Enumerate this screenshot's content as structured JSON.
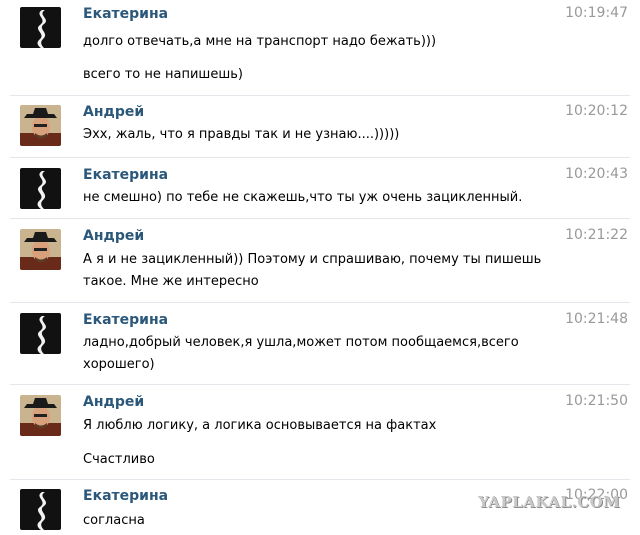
{
  "messages": [
    {
      "author": "Екатерина",
      "avatar": "ekaterina-avatar",
      "time": "10:19:47",
      "lines": [
        "долго отвечать,а мне на транспорт надо бежать)))",
        "всего то не напишешь)"
      ]
    },
    {
      "author": "Андрей",
      "avatar": "andrey-avatar",
      "time": "10:20:12",
      "lines": [
        "Эхх, жаль, что я правды так и не узнаю....)))))"
      ]
    },
    {
      "author": "Екатерина",
      "avatar": "ekaterina-avatar",
      "time": "10:20:43",
      "lines": [
        "не смешно) по тебе не скажешь,что ты уж очень зацикленный."
      ]
    },
    {
      "author": "Андрей",
      "avatar": "andrey-avatar",
      "time": "10:21:22",
      "lines": [
        "А я и не зацикленный)) Поэтому и спрашиваю, почему ты пишешь",
        "такое. Мне же интересно"
      ]
    },
    {
      "author": "Екатерина",
      "avatar": "ekaterina-avatar",
      "time": "10:21:48",
      "lines": [
        "ладно,добрый человек,я ушла,может потом пообщаемся,всего",
        "хорошего)"
      ]
    },
    {
      "author": "Андрей",
      "avatar": "andrey-avatar",
      "time": "10:21:50",
      "lines": [
        "Я люблю логику, а логика основывается на фактах",
        "Счастливо"
      ]
    },
    {
      "author": "Екатерина",
      "avatar": "ekaterina-avatar",
      "time": "10:22:00",
      "lines": [
        "согласна"
      ]
    }
  ],
  "watermark": "YAPLAKAL.COM",
  "colors": {
    "author": "#2b587a",
    "time": "#999999",
    "text": "#000000",
    "separator": "#e4e8ec"
  }
}
